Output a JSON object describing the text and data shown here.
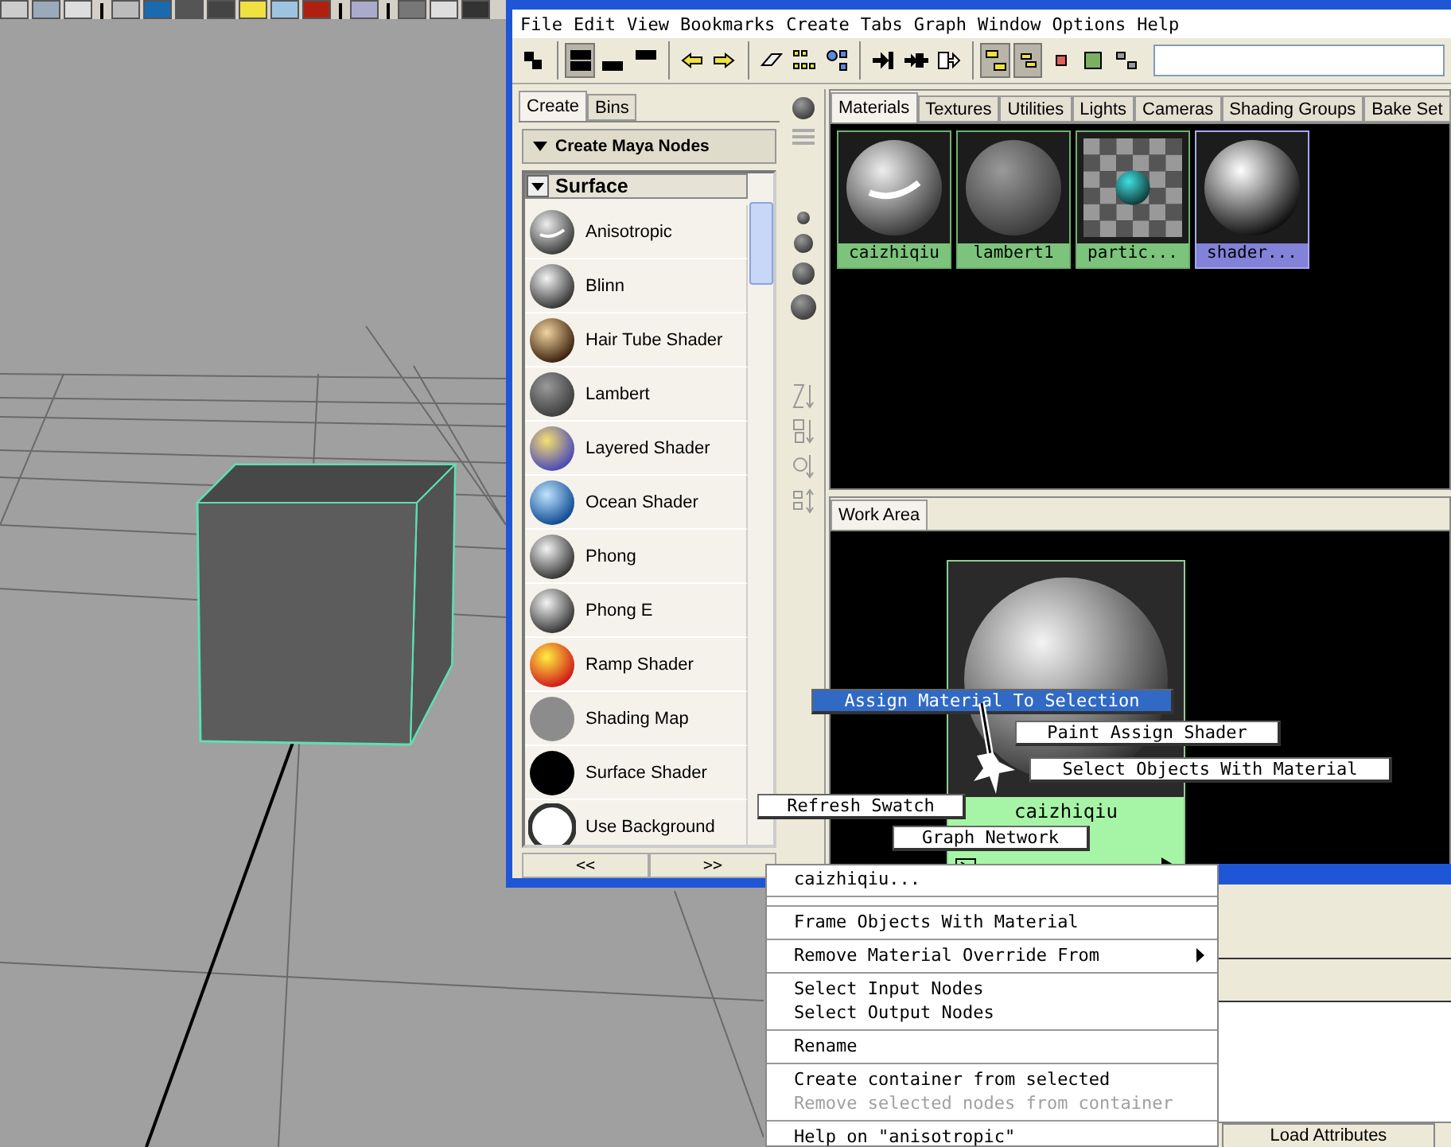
{
  "menubar": [
    "File",
    "Edit",
    "View",
    "Bookmarks",
    "Create",
    "Tabs",
    "Graph",
    "Window",
    "Options",
    "Help"
  ],
  "create_panel": {
    "tabs": [
      {
        "label": "Create",
        "selected": true
      },
      {
        "label": "Bins",
        "selected": false
      }
    ],
    "section": "Create Maya Nodes",
    "category": "Surface",
    "nodes": [
      {
        "name": "Anisotropic",
        "kind": "anisotropic"
      },
      {
        "name": "Blinn",
        "kind": "glossy"
      },
      {
        "name": "Hair Tube Shader",
        "kind": "hair"
      },
      {
        "name": "Lambert",
        "kind": "matte"
      },
      {
        "name": "Layered Shader",
        "kind": "layered"
      },
      {
        "name": "Ocean Shader",
        "kind": "ocean"
      },
      {
        "name": "Phong",
        "kind": "glossy"
      },
      {
        "name": "Phong E",
        "kind": "glossy"
      },
      {
        "name": "Ramp Shader",
        "kind": "ramp"
      },
      {
        "name": "Shading Map",
        "kind": "flat"
      },
      {
        "name": "Surface Shader",
        "kind": "black"
      },
      {
        "name": "Use Background",
        "kind": "ring"
      }
    ],
    "nav_buttons": [
      "<<",
      ">>"
    ]
  },
  "browser_tabs": [
    {
      "label": "Materials",
      "selected": true
    },
    {
      "label": "Textures",
      "selected": false
    },
    {
      "label": "Utilities",
      "selected": false
    },
    {
      "label": "Lights",
      "selected": false
    },
    {
      "label": "Cameras",
      "selected": false
    },
    {
      "label": "Shading Groups",
      "selected": false
    },
    {
      "label": "Bake Set",
      "selected": false
    }
  ],
  "materials": [
    {
      "name": "caizhiqiu",
      "kind": "anisotropic",
      "selected": false
    },
    {
      "name": "lambert1",
      "kind": "matte",
      "selected": false
    },
    {
      "name": "partic...",
      "kind": "particle",
      "selected": false
    },
    {
      "name": "shader...",
      "kind": "shiny",
      "selected": true
    }
  ],
  "work_area": {
    "tab": "Work Area",
    "node": {
      "name": "caizhiqiu"
    }
  },
  "marking_menu": [
    {
      "label": "Assign Material To Selection",
      "selected": true
    },
    {
      "label": "Paint Assign Shader",
      "selected": false
    },
    {
      "label": "Select Objects With Material",
      "selected": false
    },
    {
      "label": "Refresh Swatch",
      "selected": false
    },
    {
      "label": "Graph Network",
      "selected": false
    }
  ],
  "context_menu": [
    {
      "kind": "item",
      "label": "caizhiqiu...",
      "disabled": false,
      "submenu": false
    },
    {
      "kind": "separator"
    },
    {
      "kind": "separator"
    },
    {
      "kind": "item",
      "label": "Frame Objects With Material",
      "disabled": false,
      "submenu": false
    },
    {
      "kind": "separator"
    },
    {
      "kind": "item",
      "label": "Remove Material Override From",
      "disabled": false,
      "submenu": true
    },
    {
      "kind": "separator"
    },
    {
      "kind": "item",
      "label": "Select Input Nodes",
      "disabled": false,
      "submenu": false
    },
    {
      "kind": "item",
      "label": "Select Output Nodes",
      "disabled": false,
      "submenu": false
    },
    {
      "kind": "separator"
    },
    {
      "kind": "item",
      "label": "Rename",
      "disabled": false,
      "submenu": false
    },
    {
      "kind": "separator"
    },
    {
      "kind": "item",
      "label": "Create container from selected",
      "disabled": false,
      "submenu": false
    },
    {
      "kind": "item",
      "label": "Remove selected nodes from container",
      "disabled": true,
      "submenu": false
    },
    {
      "kind": "separator"
    },
    {
      "kind": "item",
      "label": "Help on \"anisotropic\"",
      "disabled": false,
      "submenu": false
    }
  ],
  "attribute_editor": {
    "button": "Load Attributes"
  }
}
